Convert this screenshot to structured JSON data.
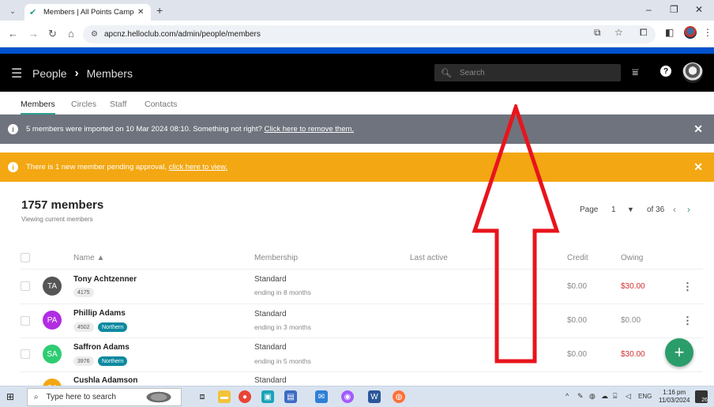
{
  "browser": {
    "tab_title": "Members | All Points Camping",
    "url": "apcnz.helloclub.com/admin/people/members"
  },
  "header": {
    "crumb_parent": "People",
    "crumb_current": "Members",
    "search_placeholder": "Search"
  },
  "subtabs": [
    "Members",
    "Circles",
    "Staff",
    "Contacts"
  ],
  "banners": {
    "import_msg": "5 members were imported on 10 Mar 2024 08:10. Something not right?",
    "import_link": "Click here to remove them.",
    "pending_msg": "There is 1 new member pending approval,",
    "pending_link": "click here to view."
  },
  "summary": {
    "count": "1757 members",
    "sub": "Viewing current members"
  },
  "pager": {
    "label": "Page",
    "current": "1",
    "of": "of 36"
  },
  "table": {
    "headers": [
      "Name ▲",
      "Membership",
      "Last active",
      "Credit",
      "Owing"
    ],
    "rows": [
      {
        "initials": "TA",
        "name": "Tony Achtzenner",
        "number": "4175",
        "group": "",
        "type": "Standard",
        "ending": "ending in 8 months",
        "credit": "$0.00",
        "owing": "$30.00"
      },
      {
        "initials": "PA",
        "name": "Phillip Adams",
        "number": "4502",
        "group": "Northern",
        "type": "Standard",
        "ending": "ending in 3 months",
        "credit": "$0.00",
        "owing": "$0.00"
      },
      {
        "initials": "SA",
        "name": "Saffron Adams",
        "number": "3976",
        "group": "Northern",
        "type": "Standard",
        "ending": "ending in 5 months",
        "credit": "$0.00",
        "owing": "$30.00"
      },
      {
        "initials": "CA",
        "name": "Cushla Adamson",
        "number": "",
        "group": "",
        "type": "Standard",
        "ending": "",
        "credit": "",
        "owing": ""
      }
    ]
  },
  "colors": {
    "accent": "#2a9d8f",
    "owing_red": "#d32f2f",
    "banner_grey": "#6e737d",
    "banner_orange": "#f3a712",
    "annotation_red": "#e8141c"
  },
  "taskbar": {
    "search_placeholder": "Type here to search",
    "lang": "ENG",
    "time": "1:16 pm",
    "date": "11/03/2024",
    "notif_count": "26"
  }
}
